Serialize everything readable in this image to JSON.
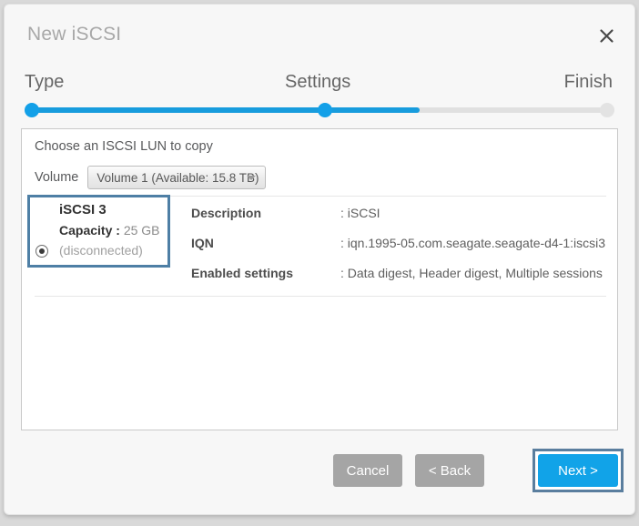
{
  "dialog": {
    "title": "New iSCSI",
    "close_icon": "close-icon"
  },
  "stepper": {
    "steps": [
      {
        "label": "Type",
        "state": "done"
      },
      {
        "label": "Settings",
        "state": "current"
      },
      {
        "label": "Finish",
        "state": "future"
      }
    ],
    "active_index": 1,
    "fill_color": "#189cdd",
    "track_color": "#e0e0e0"
  },
  "panel": {
    "heading": "Choose an ISCSI LUN to copy",
    "volume": {
      "label": "Volume",
      "selected": "Volume 1 (Available: 15.8 TB)",
      "caret_icon": "chevron-down-icon"
    },
    "lun": {
      "name": "iSCSI 3",
      "capacity_label": "Capacity :",
      "capacity_value": "25 GB",
      "status": "(disconnected)",
      "selected": true,
      "border_color": "#4e7fa5"
    },
    "details": [
      {
        "label": "Description",
        "value": ": iSCSI"
      },
      {
        "label": "IQN",
        "value": ": iqn.1995-05.com.seagate.seagate-d4-1:iscsi3"
      },
      {
        "label": "Enabled settings",
        "value": ": Data digest, Header digest, Multiple sessions"
      }
    ]
  },
  "footer": {
    "cancel_label": "Cancel",
    "back_label": "< Back",
    "next_label": "Next >",
    "next_accent": "#11a3e8",
    "focus_ring_color": "#5a7e9e"
  }
}
